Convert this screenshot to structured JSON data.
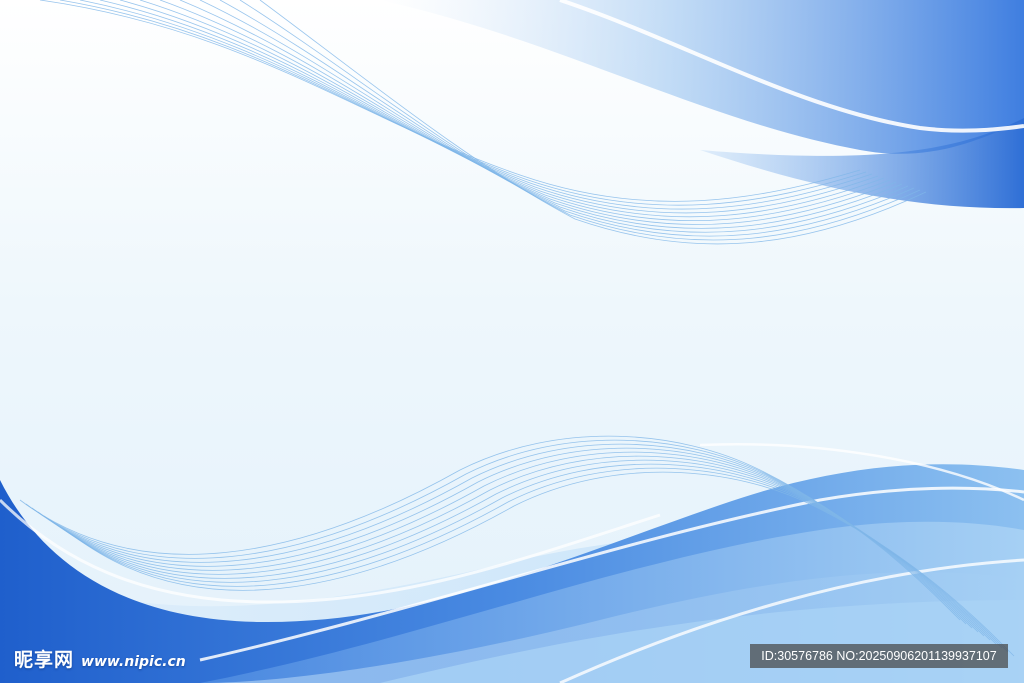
{
  "palette": {
    "background_light": "#eef7fc",
    "wave_deep": "#2f6fd6",
    "wave_mid": "#5c9be6",
    "wave_light": "#9cc8f0",
    "line_color": "#7fb6e8",
    "highlight": "#ffffff"
  },
  "watermark": {
    "site_name": "昵享网",
    "site_url": "www.nipic.cn",
    "id_text": "ID:30576786 NO:20250906201139937107"
  }
}
